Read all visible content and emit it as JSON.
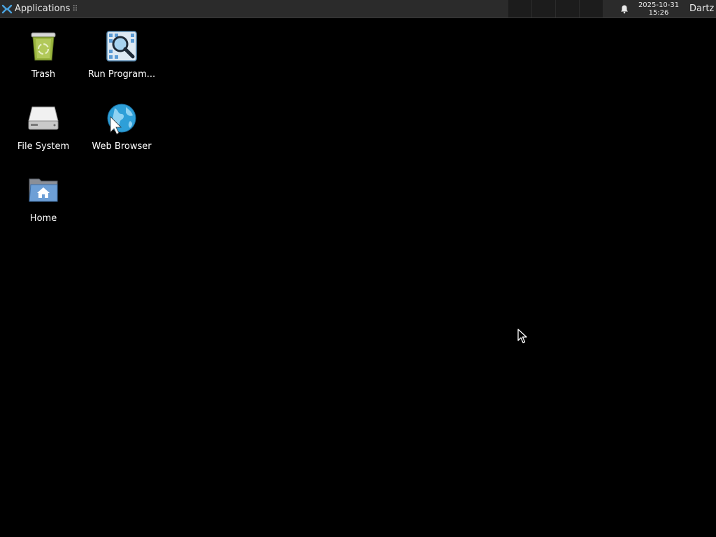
{
  "panel": {
    "applications_label": "Applications",
    "handle_glyph": "⠿",
    "clock": {
      "date": "2025-10-31",
      "time": "15:26"
    },
    "user": "Dartz",
    "notification_icon": "bell-icon"
  },
  "desktop": {
    "icons": [
      {
        "label": "Trash",
        "icon": "trash-icon"
      },
      {
        "label": "Run Program...",
        "icon": "run-program-icon"
      },
      {
        "label": "File System",
        "icon": "drive-icon"
      },
      {
        "label": "Web Browser",
        "icon": "globe-icon"
      },
      {
        "label": "Home",
        "icon": "home-folder-icon"
      }
    ]
  },
  "colors": {
    "panel_bg": "#2b2b2b",
    "desktop_bg": "#000000",
    "text": "#ffffff"
  }
}
